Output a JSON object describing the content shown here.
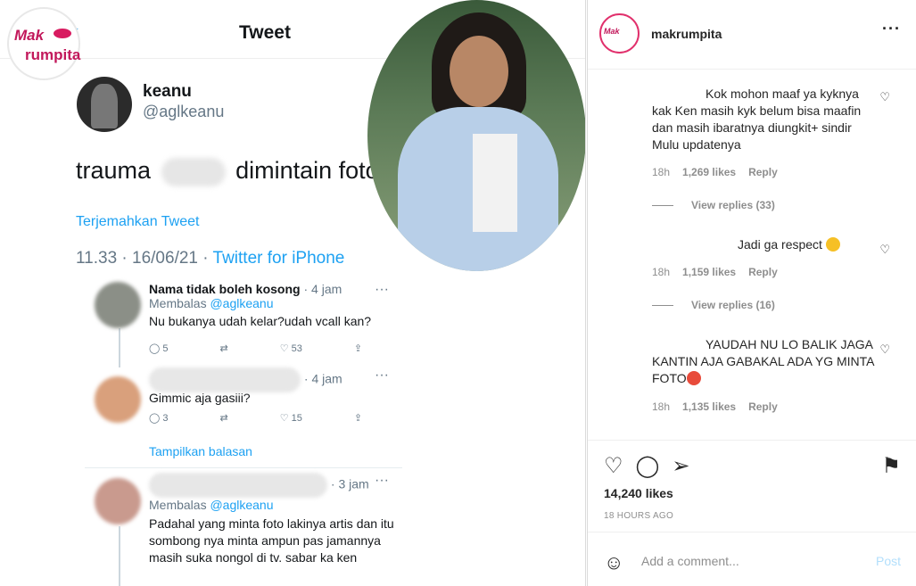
{
  "post_image": {
    "brand_logo": {
      "line1": "Mak",
      "line2": "rumpita"
    },
    "tweet_header_title": "Tweet",
    "author": {
      "name": "keanu",
      "handle": "@aglkeanu"
    },
    "tweet_text_before": "trauma",
    "tweet_text_after": "dimintain foto",
    "translate_label": "Terjemahkan Tweet",
    "timestamp": "11.33 · 16/06/21 · ",
    "source": "Twitter for iPhone",
    "replies": [
      {
        "name": "Nama tidak boleh kosong",
        "time": "· 4 jam",
        "replying": "Membalas ",
        "replying_handle": "@aglkeanu",
        "text": "Nu bukanya udah kelar?udah vcall kan?",
        "comments": "5",
        "retweets": "",
        "likes": "53"
      },
      {
        "name": "",
        "time": "· 4 jam",
        "replying": "",
        "replying_handle": "",
        "text": "Gimmic aja gasiii?",
        "comments": "3",
        "retweets": "",
        "likes": "15"
      },
      {
        "name": "",
        "time": "· 3 jam",
        "replying": "Membalas ",
        "replying_handle": "@aglkeanu",
        "text": "Padahal yang minta foto lakinya artis dan itu sombong nya minta ampun pas jamannya masih suka nongol di tv. sabar ka ken",
        "comments": "",
        "retweets": "",
        "likes": ""
      }
    ],
    "show_replies": "Tampilkan balasan"
  },
  "panel": {
    "username": "makrumpita",
    "more_icon": "more-options-icon",
    "comments": [
      {
        "text": "Kok mohon maaf ya kyknya kak Ken masih kyk belum bisa maafin dan masih ibaratnya diungkit+ sindir Mulu updatenya",
        "age": "18h",
        "likes": "1,269 likes",
        "reply": "Reply",
        "view_replies": "View replies (33)"
      },
      {
        "text": "Jadi ga respect",
        "age": "18h",
        "likes": "1,159 likes",
        "reply": "Reply",
        "view_replies": "View replies (16)"
      },
      {
        "text": "YAUDAH NU LO BALIK JAGA KANTIN AJA GABAKAL ADA YG MINTA FOTO",
        "age": "18h",
        "likes": "1,135 likes",
        "reply": "Reply",
        "view_replies": ""
      }
    ],
    "likes_count": "14,240 likes",
    "time_ago": "18 HOURS AGO",
    "add_comment_placeholder": "Add a comment...",
    "post_button": "Post"
  }
}
